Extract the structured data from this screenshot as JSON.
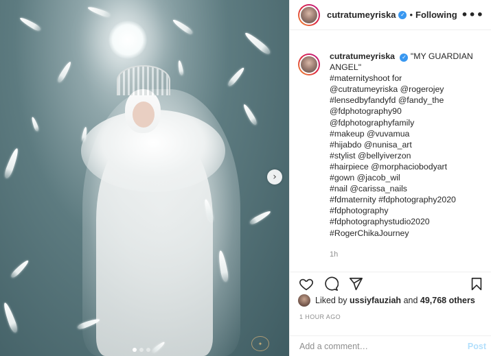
{
  "post": {
    "username": "cutratumeyriska",
    "follow_sep": "•",
    "follow_state": "Following",
    "more_glyph": "•••",
    "verified_glyph": "✓"
  },
  "caption": {
    "username": "cutratumeyriska",
    "lines": [
      "\"MY GUARDIAN",
      "ANGEL\"",
      "#maternityshoot for",
      "@cutratumeyriska @rogerojey",
      "#lensedbyfandyfd @fandy_the",
      "@fdphotography90",
      "@fdphotographyfamily",
      "#makeup @vuvamua",
      "#hijabdo @nunisa_art",
      "#stylist @bellyiverzon",
      "#hairpiece @morphaciobodyart",
      "#gown @jacob_wil",
      "#nail @carissa_nails",
      "#fdmaternity #fdphotography2020",
      "#fdphotography",
      "#fdphotographystudio2020",
      "#RogerChikaJourney"
    ],
    "time": "1h"
  },
  "actions": {
    "icons": [
      "heart-icon",
      "comment-icon",
      "share-icon",
      "bookmark-icon"
    ]
  },
  "likes": {
    "prefix": "Liked by",
    "user": "ussiyfauziah",
    "joiner": "and",
    "count": "49,768 others"
  },
  "timestamp": "1 HOUR AGO",
  "comment_box": {
    "placeholder": "Add a comment…",
    "post_label": "Post"
  },
  "photo": {
    "next_glyph": "›",
    "dots": 3,
    "active_dot": 0
  },
  "colors": {
    "link_blue": "#3897f0",
    "post_disabled": "#b2dffc",
    "muted": "#8e8e8e"
  }
}
